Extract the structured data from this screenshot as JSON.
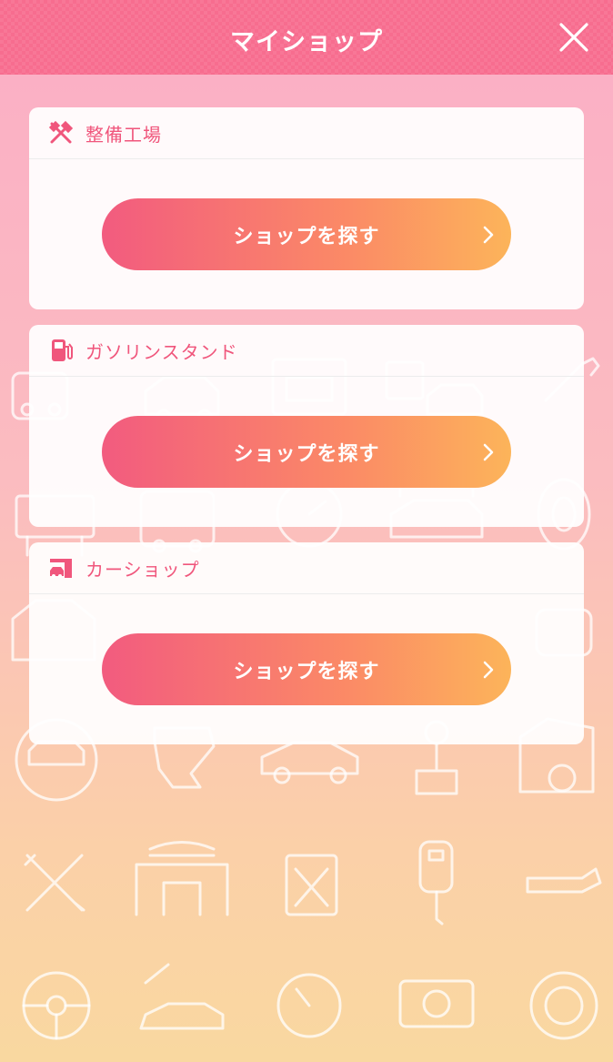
{
  "header": {
    "title": "マイショップ",
    "close_icon": "close-icon"
  },
  "cards": [
    {
      "title": "整備工場",
      "icon": "tools-icon",
      "button_label": "ショップを探す"
    },
    {
      "title": "ガソリンスタンド",
      "icon": "gas-pump-icon",
      "button_label": "ショップを探す"
    },
    {
      "title": "カーショップ",
      "icon": "car-shop-icon",
      "button_label": "ショップを探す"
    }
  ],
  "colors": {
    "header": "#f76d8f",
    "accent_text": "#f0567c",
    "button_start": "#f25b7f",
    "button_end": "#fcb45a"
  }
}
